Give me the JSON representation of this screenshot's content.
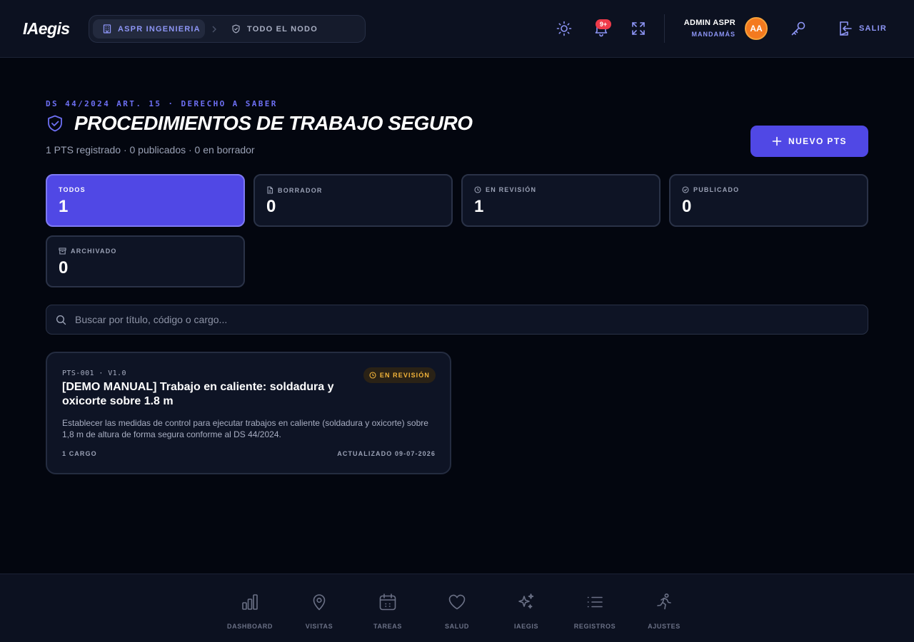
{
  "header": {
    "logo": "IAegis",
    "breadcrumb": {
      "company": "ASPR INGENIERIA",
      "scope": "TODO EL NODO"
    },
    "notifications_count": "9+",
    "user": {
      "name": "ADMIN ASPR",
      "role": "MANDAMÁS",
      "initials": "AA"
    },
    "logout_label": "SALIR"
  },
  "page": {
    "eyebrow": "DS 44/2024 ART. 15 · DERECHO A SABER",
    "title": "PROCEDIMIENTOS DE TRABAJO SEGURO",
    "subtitle": "1 PTS registrado · 0 publicados · 0 en borrador",
    "new_button_label": "NUEVO PTS"
  },
  "stats": [
    {
      "label": "TODOS",
      "value": "1",
      "icon": "none",
      "active": true
    },
    {
      "label": "BORRADOR",
      "value": "0",
      "icon": "document-icon",
      "active": false
    },
    {
      "label": "EN REVISIÓN",
      "value": "1",
      "icon": "clock-icon",
      "active": false
    },
    {
      "label": "PUBLICADO",
      "value": "0",
      "icon": "check-circle-icon",
      "active": false
    },
    {
      "label": "ARCHIVADO",
      "value": "0",
      "icon": "archive-icon",
      "active": false
    }
  ],
  "search": {
    "placeholder": "Buscar por título, código o cargo..."
  },
  "cards": [
    {
      "code": "PTS-001 · V1.0",
      "status": "EN REVISIÓN",
      "title": "[DEMO MANUAL] Trabajo en caliente: soldadura y oxicorte sobre 1.8 m",
      "description": "Establecer las medidas de control para ejecutar trabajos en caliente (soldadura y oxicorte) sobre 1,8 m de altura de forma segura conforme al DS 44/2024.",
      "roles": "1 CARGO",
      "updated": "ACTUALIZADO 09-07-2026"
    }
  ],
  "bottom_nav": [
    {
      "label": "DASHBOARD",
      "icon": "bar-chart-icon"
    },
    {
      "label": "VISITAS",
      "icon": "map-pin-icon"
    },
    {
      "label": "TAREAS",
      "icon": "calendar-icon"
    },
    {
      "label": "SALUD",
      "icon": "heart-icon"
    },
    {
      "label": "IAEGIS",
      "icon": "sparkles-icon"
    },
    {
      "label": "REGISTROS",
      "icon": "list-icon"
    },
    {
      "label": "AJUSTES",
      "icon": "runner-icon"
    }
  ],
  "colors": {
    "accent": "#5048e5",
    "accent_text": "#8d95f5",
    "status_review": "#f3b43a",
    "background": "#03060f",
    "surface": "#0e1425"
  }
}
